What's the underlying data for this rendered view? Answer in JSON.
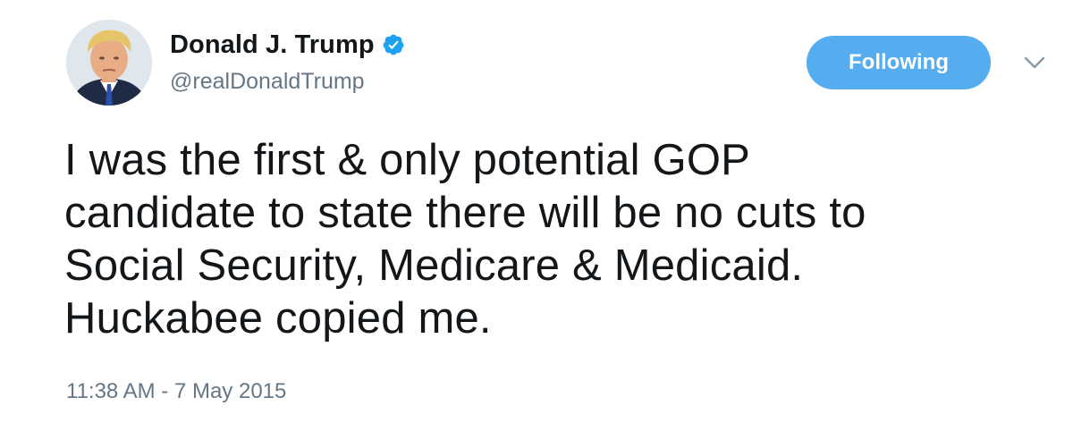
{
  "author": {
    "display_name": "Donald J. Trump",
    "handle": "@realDonaldTrump",
    "verified": true,
    "avatar_icon": "profile-photo"
  },
  "actions": {
    "follow_label": "Following",
    "more_icon": "chevron-down-icon"
  },
  "tweet": {
    "text_lines": [
      "I was the first & only potential GOP",
      "candidate to state there will be no cuts to",
      "Social Security, Medicare & Medicaid.",
      "Huckabee copied me."
    ],
    "timestamp": "11:38 AM - 7 May 2015"
  },
  "colors": {
    "accent": "#55acee",
    "verified_badge": "#1da1f2",
    "secondary_text": "#657786",
    "primary_text": "#14171a"
  }
}
